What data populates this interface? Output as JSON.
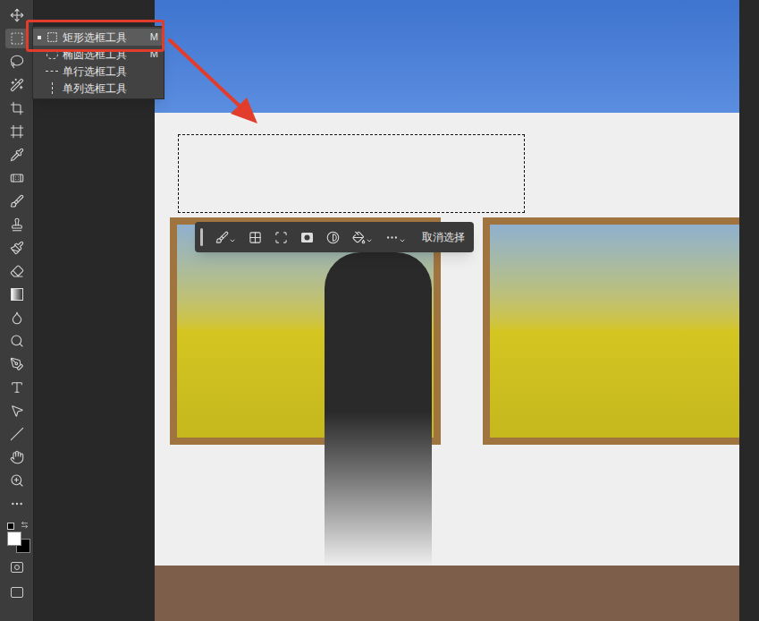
{
  "toolbar": {
    "tools": [
      {
        "kind": "move",
        "selected": false
      },
      {
        "kind": "marquee",
        "selected": true
      },
      {
        "kind": "lasso",
        "selected": false
      },
      {
        "kind": "wand",
        "selected": false
      },
      {
        "kind": "crop",
        "selected": false
      },
      {
        "kind": "frame",
        "selected": false
      },
      {
        "kind": "eyedropper",
        "selected": false
      },
      {
        "kind": "healing",
        "selected": false
      },
      {
        "kind": "brush",
        "selected": false
      },
      {
        "kind": "stamp",
        "selected": false
      },
      {
        "kind": "history",
        "selected": false
      },
      {
        "kind": "eraser",
        "selected": false
      },
      {
        "kind": "gradient",
        "selected": false
      },
      {
        "kind": "blur",
        "selected": false
      },
      {
        "kind": "dodge",
        "selected": false
      },
      {
        "kind": "pen",
        "selected": false
      },
      {
        "kind": "type",
        "selected": false
      },
      {
        "kind": "path",
        "selected": false
      },
      {
        "kind": "line",
        "selected": false
      },
      {
        "kind": "hand",
        "selected": false
      },
      {
        "kind": "zoom",
        "selected": false
      },
      {
        "kind": "more",
        "selected": false
      }
    ]
  },
  "flyout": {
    "items": [
      {
        "label": "矩形选框工具",
        "shortcut": "M",
        "current": true,
        "selected": true
      },
      {
        "label": "椭圆选框工具",
        "shortcut": "M",
        "current": false,
        "selected": false
      },
      {
        "label": "单行选框工具",
        "current": false,
        "selected": false
      },
      {
        "label": "单列选框工具",
        "current": false,
        "selected": false
      }
    ]
  },
  "canvas": {
    "marquee_selection": true
  },
  "task_bar": {
    "tools": [
      {
        "kind": "brush",
        "dropdown": true
      },
      {
        "kind": "checker",
        "dropdown": false
      },
      {
        "kind": "scan",
        "dropdown": false
      },
      {
        "kind": "mask",
        "dropdown": false
      },
      {
        "kind": "contrast",
        "dropdown": false
      },
      {
        "kind": "bucket",
        "dropdown": true
      },
      {
        "kind": "more",
        "dropdown": true
      }
    ],
    "button": "取消选择"
  }
}
